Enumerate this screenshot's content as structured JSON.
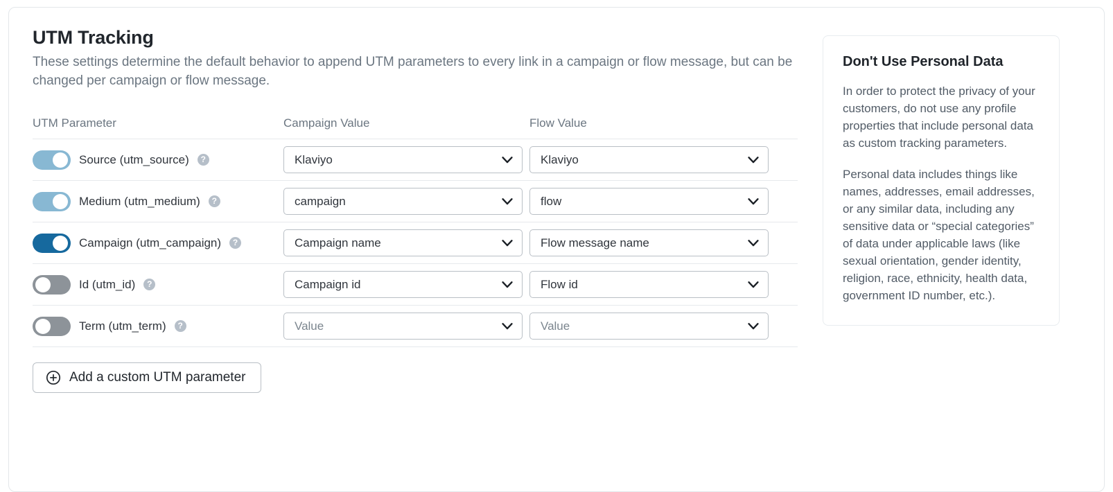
{
  "page": {
    "title": "UTM Tracking",
    "description": "These settings determine the default behavior to append UTM parameters to every link in a campaign or flow message, but can be changed per campaign or flow message."
  },
  "table": {
    "headers": {
      "parameter": "UTM Parameter",
      "campaign_value": "Campaign Value",
      "flow_value": "Flow Value"
    },
    "rows": [
      {
        "label": "Source (utm_source)",
        "toggle_state": "on-light",
        "help": "?",
        "campaign_value": "Klaviyo",
        "flow_value": "Klaviyo",
        "campaign_is_placeholder": false,
        "flow_is_placeholder": false
      },
      {
        "label": "Medium (utm_medium)",
        "toggle_state": "on-light",
        "help": "?",
        "campaign_value": "campaign",
        "flow_value": "flow",
        "campaign_is_placeholder": false,
        "flow_is_placeholder": false
      },
      {
        "label": "Campaign (utm_campaign)",
        "toggle_state": "on-dark",
        "help": "?",
        "campaign_value": "Campaign name",
        "flow_value": "Flow message name",
        "campaign_is_placeholder": false,
        "flow_is_placeholder": false
      },
      {
        "label": "Id (utm_id)",
        "toggle_state": "off",
        "help": "?",
        "campaign_value": "Campaign id",
        "flow_value": "Flow id",
        "campaign_is_placeholder": false,
        "flow_is_placeholder": false
      },
      {
        "label": "Term (utm_term)",
        "toggle_state": "off",
        "help": "?",
        "campaign_value": "Value",
        "flow_value": "Value",
        "campaign_is_placeholder": true,
        "flow_is_placeholder": true
      }
    ]
  },
  "add_button": {
    "label": "Add a custom UTM parameter",
    "icon": "plus-circle-icon"
  },
  "side_panel": {
    "title": "Don't Use Personal Data",
    "paragraphs": [
      "In order to protect the privacy of your customers, do not use any profile properties that include personal data as custom tracking parameters.",
      "Personal data includes things like names, addresses, email addresses, or any similar data, including any sensitive data or “special categories” of data under applicable laws (like sexual orientation, gender identity, religion, race, ethnicity, health data, government ID number, etc.)."
    ]
  },
  "colors": {
    "toggle_on_light": "#88b8d3",
    "toggle_on_dark": "#16699e",
    "toggle_off": "#8d9399",
    "text_primary": "#30353c",
    "text_muted": "#6b7681",
    "border": "#b9bfc5"
  }
}
